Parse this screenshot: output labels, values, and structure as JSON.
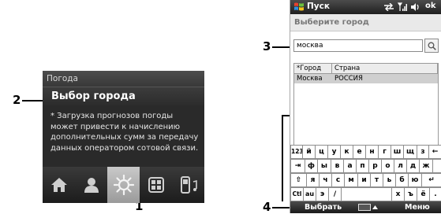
{
  "callouts": {
    "c1": "1",
    "c2": "2",
    "c3": "3",
    "c4": "4"
  },
  "left_panel": {
    "header": "Погода",
    "title": "Выбор города",
    "note": "* Загрузка прогнозов погоды может привести к начислению дополнительных сумм за передачу данных оператором сотовой связи.",
    "tabs": [
      {
        "icon": "home-icon",
        "selected": false
      },
      {
        "icon": "person-icon",
        "selected": false
      },
      {
        "icon": "weather-sun-icon",
        "selected": true
      },
      {
        "icon": "programs-grid-icon",
        "selected": false
      },
      {
        "icon": "phone-music-icon",
        "selected": false
      }
    ]
  },
  "right_panel": {
    "status": {
      "start_label": "Пуск",
      "ok_label": "ok"
    },
    "title": "Выберите город",
    "search": {
      "value": "москва"
    },
    "table": {
      "headers": [
        "*Город",
        "Страна"
      ],
      "rows": [
        {
          "city": "Москва",
          "country": "РОССИЯ"
        }
      ]
    },
    "keyboard": {
      "rows": [
        [
          "123",
          "й",
          "ц",
          "у",
          "к",
          "е",
          "н",
          "г",
          "ш",
          "щ",
          "з",
          "←"
        ],
        [
          "⇥",
          "ф",
          "ы",
          "в",
          "а",
          "п",
          "р",
          "о",
          "л",
          "д",
          "ж",
          ""
        ],
        [
          "⇧",
          "я",
          "ч",
          "с",
          "м",
          "и",
          "т",
          "ь",
          "б",
          "ю",
          "↵"
        ],
        [
          "Ctl",
          "au",
          "э",
          "/",
          "",
          "х",
          "ъ",
          "ё",
          "."
        ]
      ]
    },
    "softbar": {
      "left": "Выбрать",
      "right": "Меню"
    }
  },
  "colors": {
    "panel_dark": "#2a2a2a",
    "tab_selected": "#b5b5b5",
    "row_highlight": "#cfcfcf"
  }
}
